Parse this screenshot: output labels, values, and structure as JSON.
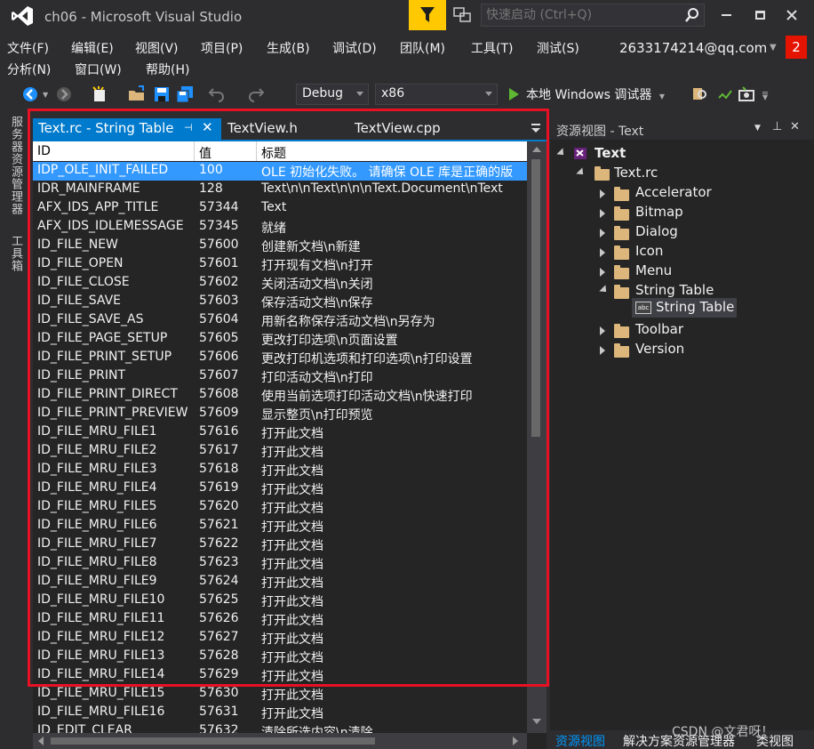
{
  "window": {
    "title": "ch06 - Microsoft Visual Studio",
    "quick_launch_placeholder": "快速启动 (Ctrl+Q)"
  },
  "menu": {
    "row1": [
      "文件(F)",
      "编辑(E)",
      "视图(V)",
      "项目(P)",
      "生成(B)",
      "调试(D)",
      "团队(M)",
      "工具(T)",
      "测试(S)"
    ],
    "row2": [
      "分析(N)",
      "窗口(W)",
      "帮助(H)"
    ],
    "account": "2633174214@qq.com",
    "notifications": "2"
  },
  "toolbar": {
    "config": "Debug",
    "platform": "x86",
    "run_label": "本地 Windows 调试器"
  },
  "siderail": {
    "server_explorer": "服务器资源管理器",
    "toolbox": "工具箱"
  },
  "tabs": [
    {
      "label": "Text.rc - String Table",
      "active": true
    },
    {
      "label": "TextView.h",
      "active": false
    },
    {
      "label": "TextView.cpp",
      "active": false
    }
  ],
  "tab_controls": {
    "pin": "⊣",
    "close": "✕"
  },
  "string_table": {
    "columns": [
      "ID",
      "值",
      "标题"
    ],
    "rows": [
      [
        "IDP_OLE_INIT_FAILED",
        "100",
        "OLE 初始化失败。 请确保 OLE 库是正确的版"
      ],
      [
        "IDR_MAINFRAME",
        "128",
        "Text\\n\\nText\\n\\n\\nText.Document\\nText"
      ],
      [
        "AFX_IDS_APP_TITLE",
        "57344",
        "Text"
      ],
      [
        "AFX_IDS_IDLEMESSAGE",
        "57345",
        "就绪"
      ],
      [
        "ID_FILE_NEW",
        "57600",
        "创建新文档\\n新建"
      ],
      [
        "ID_FILE_OPEN",
        "57601",
        "打开现有文档\\n打开"
      ],
      [
        "ID_FILE_CLOSE",
        "57602",
        "关闭活动文档\\n关闭"
      ],
      [
        "ID_FILE_SAVE",
        "57603",
        "保存活动文档\\n保存"
      ],
      [
        "ID_FILE_SAVE_AS",
        "57604",
        "用新名称保存活动文档\\n另存为"
      ],
      [
        "ID_FILE_PAGE_SETUP",
        "57605",
        "更改打印选项\\n页面设置"
      ],
      [
        "ID_FILE_PRINT_SETUP",
        "57606",
        "更改打印机选项和打印选项\\n打印设置"
      ],
      [
        "ID_FILE_PRINT",
        "57607",
        "打印活动文档\\n打印"
      ],
      [
        "ID_FILE_PRINT_DIRECT",
        "57608",
        "使用当前选项打印活动文档\\n快速打印"
      ],
      [
        "ID_FILE_PRINT_PREVIEW",
        "57609",
        "显示整页\\n打印预览"
      ],
      [
        "ID_FILE_MRU_FILE1",
        "57616",
        "打开此文档"
      ],
      [
        "ID_FILE_MRU_FILE2",
        "57617",
        "打开此文档"
      ],
      [
        "ID_FILE_MRU_FILE3",
        "57618",
        "打开此文档"
      ],
      [
        "ID_FILE_MRU_FILE4",
        "57619",
        "打开此文档"
      ],
      [
        "ID_FILE_MRU_FILE5",
        "57620",
        "打开此文档"
      ],
      [
        "ID_FILE_MRU_FILE6",
        "57621",
        "打开此文档"
      ],
      [
        "ID_FILE_MRU_FILE7",
        "57622",
        "打开此文档"
      ],
      [
        "ID_FILE_MRU_FILE8",
        "57623",
        "打开此文档"
      ],
      [
        "ID_FILE_MRU_FILE9",
        "57624",
        "打开此文档"
      ],
      [
        "ID_FILE_MRU_FILE10",
        "57625",
        "打开此文档"
      ],
      [
        "ID_FILE_MRU_FILE11",
        "57626",
        "打开此文档"
      ],
      [
        "ID_FILE_MRU_FILE12",
        "57627",
        "打开此文档"
      ],
      [
        "ID_FILE_MRU_FILE13",
        "57628",
        "打开此文档"
      ],
      [
        "ID_FILE_MRU_FILE14",
        "57629",
        "打开此文档"
      ],
      [
        "ID_FILE_MRU_FILE15",
        "57630",
        "打开此文档"
      ],
      [
        "ID_FILE_MRU_FILE16",
        "57631",
        "打开此文档"
      ],
      [
        "ID_EDIT_CLEAR",
        "57632",
        "清除所选内容\\n清除"
      ]
    ],
    "selected_row": 0
  },
  "resource_view": {
    "title": "资源视图 - Text",
    "root": "Text",
    "rc_file": "Text.rc",
    "folders": [
      "Accelerator",
      "Bitmap",
      "Dialog",
      "Icon",
      "Menu",
      "String Table",
      "Toolbar",
      "Version"
    ],
    "string_table_child": "String Table",
    "string_table_icon_text": "abc"
  },
  "bottom_tabs": [
    "资源视图",
    "解决方案资源管理器",
    "类视图"
  ],
  "watermark": "CSDN @文君呀！",
  "colors": {
    "accent": "#007acc",
    "selection": "#3399ff",
    "highlight_box": "#e81123",
    "filter_button": "#ffc800"
  }
}
